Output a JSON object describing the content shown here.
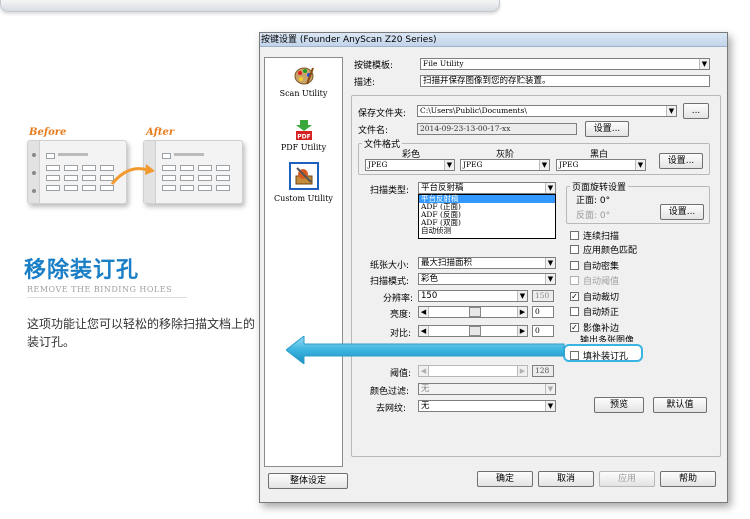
{
  "feature": {
    "before_label": "Before",
    "after_label": "After",
    "title": "移除装订孔",
    "subtitle": "REMOVE THE BINDING HOLES",
    "description": "这项功能让您可以轻松的移除扫描文档上的装订孔。"
  },
  "dialog": {
    "title": "按键设置 (Founder AnyScan Z20 Series)",
    "sidebar": [
      {
        "label": "Scan Utility",
        "icon": "palette-icon"
      },
      {
        "label": "PDF Utility",
        "icon": "pdf-icon"
      },
      {
        "label": "Custom Utility",
        "icon": "custom-icon"
      }
    ],
    "template_label": "按键模板:",
    "template_value": "File Utility",
    "desc_label": "描述:",
    "desc_value": "扫描并保存图像到您的存贮装置。",
    "save_folder_label": "保存文件夹:",
    "save_folder_value": "C:\\Users\\Public\\Documents\\",
    "browse_button": "...",
    "filename_label": "文件名:",
    "filename_value": "2014-09-23-13-00-17-xx",
    "filename_settings": "设置...",
    "format_group": "文件格式",
    "format_color": "彩色",
    "format_gray": "灰阶",
    "format_bw": "黑白",
    "format_color_value": "JPEG",
    "format_gray_value": "JPEG",
    "format_bw_value": "JPEG",
    "format_settings": "设置...",
    "scan_type_label": "扫描类型:",
    "scan_type_value": "平台反射稿",
    "scan_type_options": [
      "平台反射稿",
      "ADF (正面)",
      "ADF (反面)",
      "ADF (双面)",
      "自动侦测"
    ],
    "rotate_group": "页面旋转设置",
    "rotate_front": "正面: 0°",
    "rotate_back": "反面: 0°",
    "rotate_settings": "设置...",
    "paper_size_label": "纸张大小:",
    "paper_size_value": "最大扫描面积",
    "scan_mode_label": "扫描模式:",
    "scan_mode_value": "彩色",
    "resolution_label": "分辨率:",
    "resolution_value": "150",
    "resolution_side": "150",
    "brightness_label": "亮度:",
    "brightness_value": "0",
    "contrast_label": "对比:",
    "contrast_value": "0",
    "threshold_label": "阈值:",
    "threshold_value": "128",
    "color_filter_label": "颜色过滤:",
    "color_filter_value": "无",
    "descreen_label": "去网纹:",
    "descreen_value": "无",
    "checks": [
      {
        "label": "连续扫描",
        "checked": false,
        "enabled": true
      },
      {
        "label": "应用颜色匹配",
        "checked": false,
        "enabled": true
      },
      {
        "label": "自动密集",
        "checked": false,
        "enabled": true
      },
      {
        "label": "自动阈值",
        "checked": false,
        "enabled": false
      },
      {
        "label": "自动裁切",
        "checked": true,
        "enabled": true
      },
      {
        "label": "自动矫正",
        "checked": false,
        "enabled": true
      },
      {
        "label": "影像补边",
        "checked": true,
        "enabled": true
      },
      {
        "label": "输出多张图像",
        "checked": false,
        "enabled": true
      },
      {
        "label": "填补装订孔",
        "checked": false,
        "enabled": true
      }
    ],
    "preview_button": "预览",
    "default_button": "默认值",
    "global_button": "整体设定",
    "ok_button": "确定",
    "cancel_button": "取消",
    "apply_button": "应用",
    "help_button": "帮助",
    "check_mark": "✓",
    "dropdown_arrow": "▼",
    "left_arrow": "◀",
    "right_arrow": "▶"
  },
  "colors": {
    "accent_blue": "#1a7fc6",
    "callout_cyan": "#3ab4e0",
    "before_after": "#e87b1e"
  }
}
